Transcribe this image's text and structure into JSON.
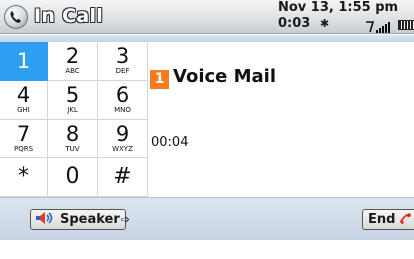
{
  "titlebar": {
    "app_icon": "phone-handset-icon",
    "title": "In Call",
    "date": "Nov 13, 1:55 pm",
    "call_duration": "0:03",
    "bluetooth_icon": "bluetooth-icon",
    "signal_icon": "signal-strength-icon",
    "battery_icon": "battery-icon"
  },
  "keypad": {
    "keys": [
      {
        "digit": "1",
        "letters": "",
        "active": true
      },
      {
        "digit": "2",
        "letters": "ABC"
      },
      {
        "digit": "3",
        "letters": "DEF"
      },
      {
        "digit": "4",
        "letters": "GHI"
      },
      {
        "digit": "5",
        "letters": "JKL"
      },
      {
        "digit": "6",
        "letters": "MNO"
      },
      {
        "digit": "7",
        "letters": "PQRS"
      },
      {
        "digit": "8",
        "letters": "TUV"
      },
      {
        "digit": "9",
        "letters": "WXYZ"
      },
      {
        "digit": "*",
        "letters": ""
      },
      {
        "digit": "0",
        "letters": ""
      },
      {
        "digit": "#",
        "letters": ""
      }
    ],
    "active_color": "#2f9ff2"
  },
  "call": {
    "speed_dial": "1",
    "contact_name": "Voice Mail",
    "timer": "00:04",
    "badge_color": "#f47b20"
  },
  "actions": {
    "speaker_label": "Speaker",
    "speaker_icon": "speakerphone-icon",
    "end_label": "End",
    "end_icon": "hang-up-icon"
  }
}
